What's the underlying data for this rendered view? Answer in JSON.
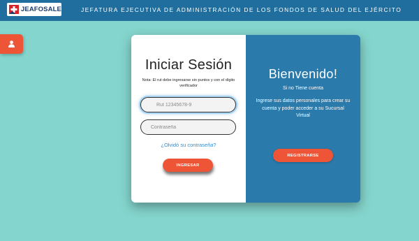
{
  "header": {
    "logo_text": "JEAFOSALE",
    "title": "JEFATURA EJECUTIVA DE ADMINISTRACIÓN DE LOS FONDOS DE SALUD DEL EJÉRCITO"
  },
  "side_tab": {
    "icon": "user-icon"
  },
  "login": {
    "title": "Iniciar Sesión",
    "note": "Nota: El rut debe ingresarse sin puntos y con el dígito verificador",
    "rut_placeholder": "Rut 12345678-9",
    "password_placeholder": "Contraseña",
    "forgot_link": "¿Olvidó su contraseña?",
    "submit_label": "INGRESAR"
  },
  "welcome": {
    "title": "Bienvenido!",
    "subtitle": "Si no Tiene cuenta",
    "body": "Ingrese sus datos personales para crear su cuenta y poder acceder a su Sucursal Virtual",
    "register_label": "REGISTRARSE"
  },
  "colors": {
    "background": "#84d5cd",
    "header": "#1f6e9e",
    "panel_blue": "#2a7aab",
    "accent": "#ee5436",
    "link": "#2b8fd6"
  }
}
